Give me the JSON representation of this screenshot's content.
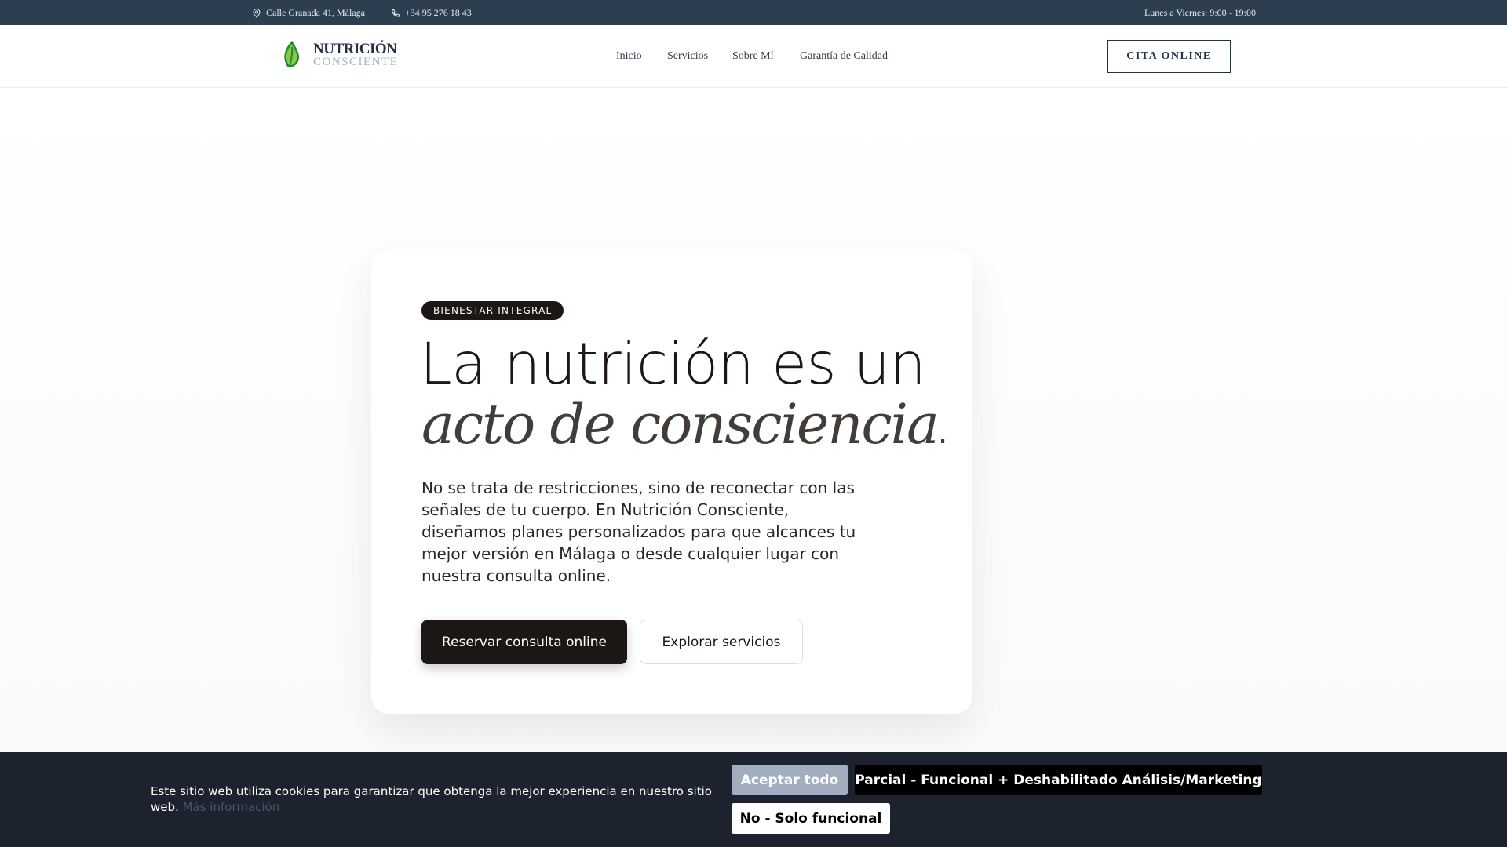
{
  "topbar": {
    "address": "Calle Granada 41, Málaga",
    "phone": "+34 95 276 18 43",
    "hours": "Lunes a Viernes: 9:00 - 19:00"
  },
  "header": {
    "brand_line1": "NUTRICIÓN",
    "brand_line2": "CONSCIENTE",
    "nav": [
      "Inicio",
      "Servicios",
      "Sobre Mí",
      "Garantía de Calidad"
    ],
    "cta": "CITA ONLINE"
  },
  "hero": {
    "badge": "BIENESTAR INTEGRAL",
    "title_line1": "La nutrición es un",
    "title_line2": "acto de consciencia",
    "title_dot": ".",
    "paragraph": "No se trata de restricciones, sino de reconectar con las señales de tu cuerpo. En Nutrición Consciente, diseñamos planes personalizados para que alcances tu mejor versión en Málaga o desde cualquier lugar con nuestra consulta online.",
    "primary_button": "Reservar consulta online",
    "secondary_button": "Explorar servicios"
  },
  "cookie": {
    "text": "Este sitio web utiliza cookies para garantizar que obtenga la mejor experiencia en nuestro sitio web.",
    "link": "Más información",
    "accept_all": "Aceptar todo",
    "partial": "Parcial - Funcional + Deshabilitado Análisis/Marketing",
    "functional_only": "No - Solo funcional"
  }
}
